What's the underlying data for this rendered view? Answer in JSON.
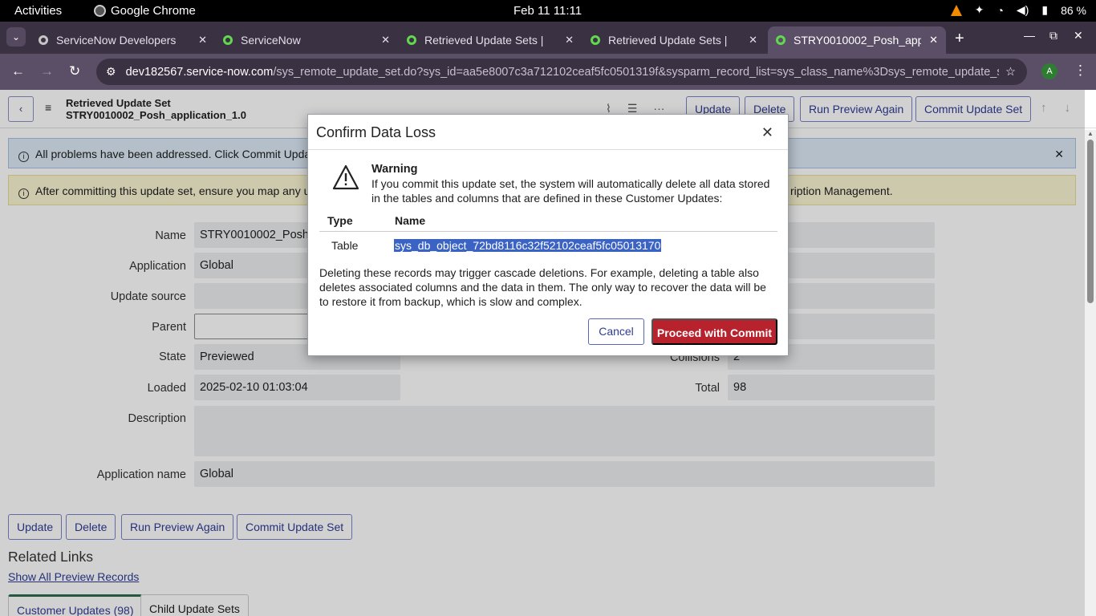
{
  "system_bar": {
    "activities": "Activities",
    "app_name": "Google Chrome",
    "clock": "Feb 11  11:11",
    "battery": "86 %"
  },
  "browser": {
    "tabs": [
      {
        "label": "ServiceNow Developers",
        "active": false
      },
      {
        "label": "ServiceNow",
        "active": false
      },
      {
        "label": "Retrieved Update Sets |",
        "active": false
      },
      {
        "label": "Retrieved Update Sets |",
        "active": false
      },
      {
        "label": "STRY0010002_Posh_app",
        "active": true
      }
    ],
    "url_host": "dev182567.service-now.com",
    "url_path": "/sys_remote_update_set.do?sys_id=aa5e8007c3a712102ceaf5fc0501319f&sysparm_record_list=sys_class_name%3Dsys_remote_update_set...",
    "profile_initial": "A"
  },
  "form_header": {
    "title_line1": "Retrieved Update Set",
    "title_line2": "STRY0010002_Posh_application_1.0",
    "buttons": [
      "Update",
      "Delete",
      "Run Preview Again",
      "Commit Update Set"
    ]
  },
  "messages": {
    "info": "All problems have been addressed. Click Commit Update",
    "warning": "After committing this update set, ensure you map any un",
    "warning_tail": "ription Management."
  },
  "fields": {
    "name": {
      "label": "Name",
      "value": "STRY0010002_Posh_a"
    },
    "application": {
      "label": "Application",
      "value": "Global"
    },
    "update_source": {
      "label": "Update source",
      "value": ""
    },
    "parent": {
      "label": "Parent",
      "value": ""
    },
    "state": {
      "label": "State",
      "value": "Previewed"
    },
    "loaded": {
      "label": "Loaded",
      "value": "2025-02-10 01:03:04"
    },
    "description": {
      "label": "Description",
      "value": ""
    },
    "application_name": {
      "label": "Application name",
      "value": "Global"
    },
    "collisions": {
      "label": "Collisions",
      "value": "2"
    },
    "total": {
      "label": "Total",
      "value": "98"
    }
  },
  "bottom_buttons": [
    "Update",
    "Delete",
    "Run Preview Again",
    "Commit Update Set"
  ],
  "related": {
    "heading": "Related Links",
    "show_all": "Show All Preview Records",
    "tabs": [
      "Customer Updates (98)",
      "Child Update Sets"
    ]
  },
  "modal": {
    "title": "Confirm Data Loss",
    "warning_title": "Warning",
    "warning_text": "If you commit this update set, the system will automatically delete all data stored in the tables and columns that are defined in these Customer Updates:",
    "col_type": "Type",
    "col_name": "Name",
    "row_type": "Table",
    "row_name": "sys_db_object_72bd8116c32f52102ceaf5fc05013170",
    "cascade_text": "Deleting these records may trigger cascade deletions. For example, deleting a table also deletes associated columns and the data in them. The only way to recover the data will be to restore it from backup, which is slow and complex.",
    "cancel": "Cancel",
    "proceed": "Proceed with Commit",
    "proceed_color": "#b7222d"
  }
}
